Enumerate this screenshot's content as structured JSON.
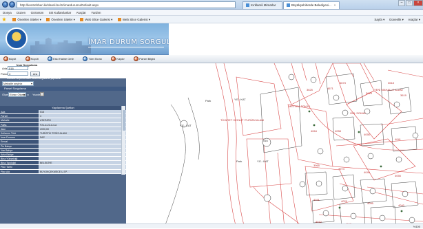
{
  "browser": {
    "address": "http://kentrehberi.kirklareli.bel.tr/imardurumu/Default.aspx",
    "tabs": [
      {
        "label": "Kırklareli Mimarlar"
      },
      {
        "label": "Büyükşehirlerde Belediyesi..."
      }
    ],
    "menu": [
      "Dosya",
      "Düzen",
      "Görünüm",
      "Sık Kullanılanlar",
      "Araçlar",
      "Yardım"
    ],
    "favorites": [
      "Önerilen Siteler ▾",
      "Önerilen Siteler ▾",
      "Web Slice Galerisi ▾",
      "Web Slice Galerisi ▾"
    ],
    "commands": [
      "Sayfa ▾",
      "Güvenlik ▾",
      "Araçlar ▾"
    ],
    "zoom": "%100"
  },
  "header": {
    "title": "İMAR DURUM SORGULAMA"
  },
  "toolbar": {
    "buttons": [
      "Büyüt",
      "Küçült",
      "Eski Haline Getir",
      "Tüm Ekran",
      "Kaydır",
      "Parsel Bilgisi"
    ]
  },
  "search": {
    "title": "İmar Sorgulama",
    "ada_label": "Ada",
    "ada_value": "516",
    "parsel_label": "Parsel",
    "parsel_value": "4",
    "ara_button": "Ara",
    "hint": "Mahalle seçerek Ada Parsel sorgulama yapılabilir.",
    "mahalle_value": "Mahalle seçiniz",
    "olcek_label": "Ölçek",
    "olcek_value": "Ekran Ölçeği",
    "yazdir": "Yazdır"
  },
  "strip1": "Parsel Sorgulama",
  "info": {
    "title": "Yapılanma Şartları",
    "rows": [
      {
        "k": "Ada",
        "v": "516"
      },
      {
        "k": "Parsel",
        "v": "4"
      },
      {
        "k": "Mahalle",
        "v": "ATATÜRK"
      },
      {
        "k": "Pafta",
        "v": "F21-d-22-d-4-a"
      },
      {
        "k": "Alan",
        "v": "2090,00"
      },
      {
        "k": "Kullanım Türü",
        "v": "TURİSTİK TESİS ALANI"
      },
      {
        "k": "İmar Durumu",
        "v": "PAP"
      },
      {
        "k": "Emsal",
        "v": ""
      },
      {
        "k": "Ön Bahçe",
        "v": ""
      },
      {
        "k": "Yan Bahçe",
        "v": ""
      },
      {
        "k": "Arka Bahçe",
        "v": ""
      },
      {
        "k": "Bina Yüksekliği",
        "v": ""
      },
      {
        "k": "Bina Tipolojisi",
        "v": "BELEDİYE"
      },
      {
        "k": "Plan Tarihi",
        "v": ""
      },
      {
        "k": "Plan Adı",
        "v": "BÜYÜKÇEKMECE U.İ.P."
      }
    ]
  },
  "map": {
    "labels": [
      {
        "text": "TİCARET+KONUT+TURİZM ALANI"
      },
      {
        "text": "Y.E.: KAT"
      },
      {
        "text": "Y.E.: KAT"
      },
      {
        "text": "Y.E.: KAT"
      },
      {
        "text": "516"
      },
      {
        "text": "Park"
      },
      {
        "text": "Park"
      },
      {
        "text": "MELTEM SOKAK"
      },
      {
        "text": "GÜL SOKAK"
      },
      {
        "text": "YENİ MAHALLE ALANI"
      }
    ],
    "parcels": [
      "3625",
      "4671",
      "4673",
      "3624",
      "3618",
      "3619",
      "3620",
      "3621",
      "4064",
      "4058",
      "4056",
      "4041",
      "4042",
      "4046",
      "3965",
      "3974",
      "4041",
      "4049",
      "4049",
      "4055",
      "4031",
      "4029",
      "4095",
      "4040",
      "4012",
      "4007",
      "4047",
      "4048",
      "3691",
      "3692",
      "3682",
      "3683",
      "3655",
      "3621",
      "3654",
      "3588",
      "3620",
      "3624"
    ]
  }
}
